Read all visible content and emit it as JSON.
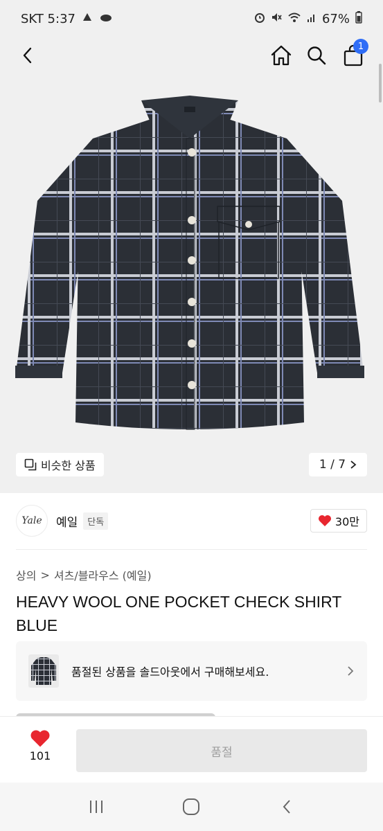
{
  "status_bar": {
    "carrier_time": "SKT 5:37",
    "battery": "67%"
  },
  "header": {
    "back_icon": "chevron-left-icon",
    "home_icon": "home-icon",
    "search_icon": "search-icon",
    "cart_icon": "shopping-bag-icon",
    "cart_count": "1"
  },
  "gallery": {
    "similar_label": "비슷한 상품",
    "pager_text": "1 / 7"
  },
  "brand": {
    "logo_text": "Yale",
    "name": "예일",
    "tag": "단독",
    "likes": "30만"
  },
  "breadcrumb": {
    "level1": "상의",
    "separator": ">",
    "level2": "셔츠/블라우스 (예일)"
  },
  "product": {
    "title": "HEAVY WOOL ONE POCKET CHECK SHIRT BLUE"
  },
  "soldout_notice": {
    "text": "품절된 상품을 솔드아웃에서 구매해보세요."
  },
  "bottom_bar": {
    "wish_count": "101",
    "buy_label": "품절"
  },
  "colors": {
    "accent_blue": "#2f6df6",
    "heart_red": "#e8262f",
    "shirt_dark": "#2b2f36"
  }
}
